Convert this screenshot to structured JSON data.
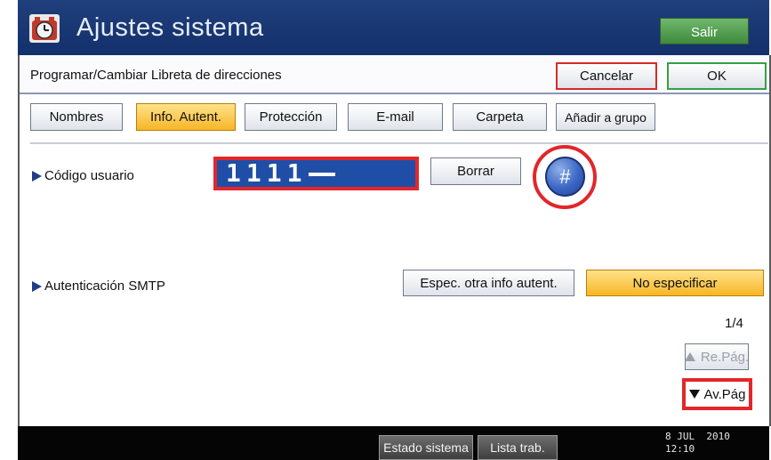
{
  "header": {
    "title": "Ajustes sistema",
    "exit_label": "Salir"
  },
  "form": {
    "heading": "Programar/Cambiar Libreta de direcciones",
    "cancel_label": "Cancelar",
    "ok_label": "OK"
  },
  "tabs": [
    {
      "label": "Nombres",
      "active": false
    },
    {
      "label": "Info. Autent.",
      "active": true
    },
    {
      "label": "Protección",
      "active": false
    },
    {
      "label": "E-mail",
      "active": false
    },
    {
      "label": "Carpeta",
      "active": false
    },
    {
      "label": "Añadir a grupo",
      "active": false
    }
  ],
  "user_code": {
    "label": "Código usuario",
    "value": "1111",
    "clear_label": "Borrar",
    "hash_label": "#"
  },
  "smtp_auth": {
    "label": "Autenticación SMTP",
    "options": [
      "Espec. otra info autent.",
      "No especificar"
    ],
    "selected": "No especificar"
  },
  "pager": {
    "page_indicator": "1/4",
    "prev_label": "Re.Pág.",
    "next_label": "Av.Pág"
  },
  "statusbar": {
    "system_status_label": "Estado sistema",
    "job_list_label": "Lista trab.",
    "date": "8 JUL  2010",
    "time": "12:10"
  },
  "colors": {
    "title_bar": "#13306b",
    "highlight": "#e2262a",
    "active_tab": "#f7b627",
    "ok_border": "#34a046"
  }
}
